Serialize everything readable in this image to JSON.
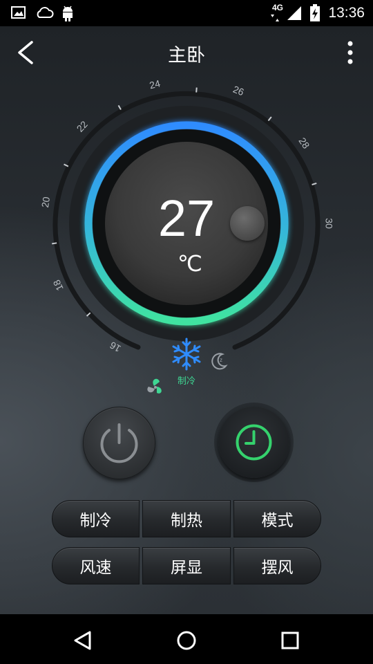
{
  "status_bar": {
    "network": "4G",
    "time": "13:36",
    "icons": [
      "image-icon",
      "cloud-icon",
      "android-icon",
      "signal-icon",
      "battery-icon"
    ]
  },
  "header": {
    "title": "主卧",
    "back_icon": "chevron-left-icon",
    "menu_icon": "more-vert-icon"
  },
  "dial": {
    "temperature": "27",
    "unit": "℃",
    "min": 16,
    "max": 30,
    "tick_labels": [
      "16",
      "18",
      "20",
      "22",
      "24",
      "26",
      "28",
      "30"
    ],
    "mode_icons": [
      "fan-icon",
      "snowflake-icon",
      "sleep-moon-icon"
    ],
    "mode_label": "制冷",
    "accent_start": "#2f8cff",
    "accent_end": "#40e3a0"
  },
  "controls": {
    "power_icon": "power-icon",
    "timer_icon": "timer-clock-icon",
    "timer_color": "#35d26d",
    "buttons": [
      [
        "制冷",
        "制热",
        "模式"
      ],
      [
        "风速",
        "屏显",
        "摆风"
      ]
    ]
  },
  "nav": {
    "icons": [
      "back-triangle-icon",
      "home-circle-icon",
      "recents-square-icon"
    ]
  }
}
